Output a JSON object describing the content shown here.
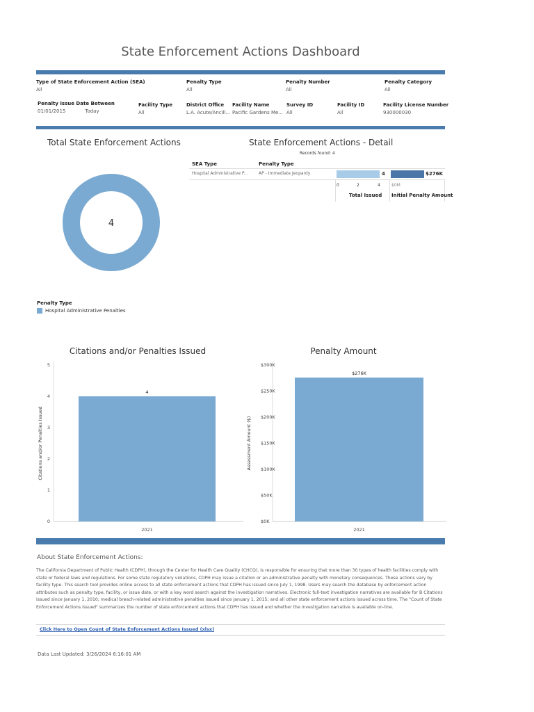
{
  "title": "State Enforcement Actions Dashboard",
  "filters_row1": [
    {
      "label": "Type of State Enforcement Action (SEA)",
      "value": "All"
    },
    {
      "label": "Penalty Type",
      "value": "All"
    },
    {
      "label": "Penalty Number",
      "value": "All"
    },
    {
      "label": "Penalty Category",
      "value": "All"
    }
  ],
  "filters_row2": {
    "date_label": "Penalty Issue Date Between",
    "date_from": "01/01/2015",
    "date_to": "Today",
    "items": [
      {
        "label": "Facility Type",
        "value": "All"
      },
      {
        "label": "District Office",
        "value": "L.A. Acute/Ancill..."
      },
      {
        "label": "Facility Name",
        "value": "Pacific Gardens Me..."
      },
      {
        "label": "Survey ID",
        "value": "All"
      },
      {
        "label": "Facility ID",
        "value": "All"
      },
      {
        "label": "Facility License Number",
        "value": "930000030"
      }
    ]
  },
  "total": {
    "title": "Total State Enforcement Actions",
    "value": "4",
    "color": "#7aaad2"
  },
  "legend": {
    "title": "Penalty Type",
    "item": "Hospital Administrative Penalties"
  },
  "detail": {
    "title": "State Enforcement Actions - Detail",
    "records": "Records found: 4",
    "col_sea": "SEA Type",
    "col_penalty": "Penalty Type",
    "row": {
      "sea": "Hospital Administrative P...",
      "penalty": "AP - Immediate Jeopardy",
      "issued": 4,
      "issued_label": "4",
      "amount_label": "$276K"
    },
    "issued_ticks": [
      "0",
      "2",
      "4"
    ],
    "amount_tick": "$0M",
    "issued_header": "Total Issued",
    "amount_header": "Initial Penalty Amount"
  },
  "chart_data": [
    {
      "type": "bar",
      "title": "Citations and/or Penalties Issued",
      "categories": [
        "2021"
      ],
      "values": [
        4
      ],
      "labels": [
        "4"
      ],
      "ylabel": "Citations and/or Penalties Issued",
      "ylim": [
        0,
        5
      ],
      "yticks": [
        "0",
        "1",
        "2",
        "3",
        "4",
        "5"
      ],
      "color": "#7aaad2"
    },
    {
      "type": "bar",
      "title": "Penalty Amount",
      "categories": [
        "2021"
      ],
      "values": [
        276000
      ],
      "labels": [
        "$276K"
      ],
      "ylabel": "Assessment Amount ($)",
      "ylim": [
        0,
        300000
      ],
      "yticks": [
        "$0K",
        "$50K",
        "$100K",
        "$150K",
        "$200K",
        "$250K",
        "$300K"
      ],
      "color": "#7aaad2"
    }
  ],
  "about": {
    "heading": "About State Enforcement Actions:",
    "text": "The California Department of Public Health (CDPH), through the Center for Health Care Quality (CHCQ), is responsible for ensuring that more than 30 types of health facilities comply with state or federal laws and regulations. For some state regulatory violations, CDPH may issue a citation or an administrative penalty with monetary consequences. These actions vary by facility type. This search tool provides online access to all state enforcement actions that CDPH has issued since July 1, 1998. Users may search the database by enforcement action attributes such as penalty type, facility, or issue date, or with a key word search against the investigation narratives. Electronic full-text investigation narratives are available for B Citations issued since January 1, 2010; medical breach-related administrative penalties issued since January 1, 2015; and all other state enforcement actions issued across time. The \"Count of State Enforcement Actions Issued\" summarizes the number of state enforcement actions that CDPH has issued and whether the investigation narrative is available on-line.",
    "link": "Click Here to Open Count of State Enforcement Actions Issued (xlsx)"
  },
  "updated": "Data Last Updated: 3/26/2024 6:16:01 AM"
}
